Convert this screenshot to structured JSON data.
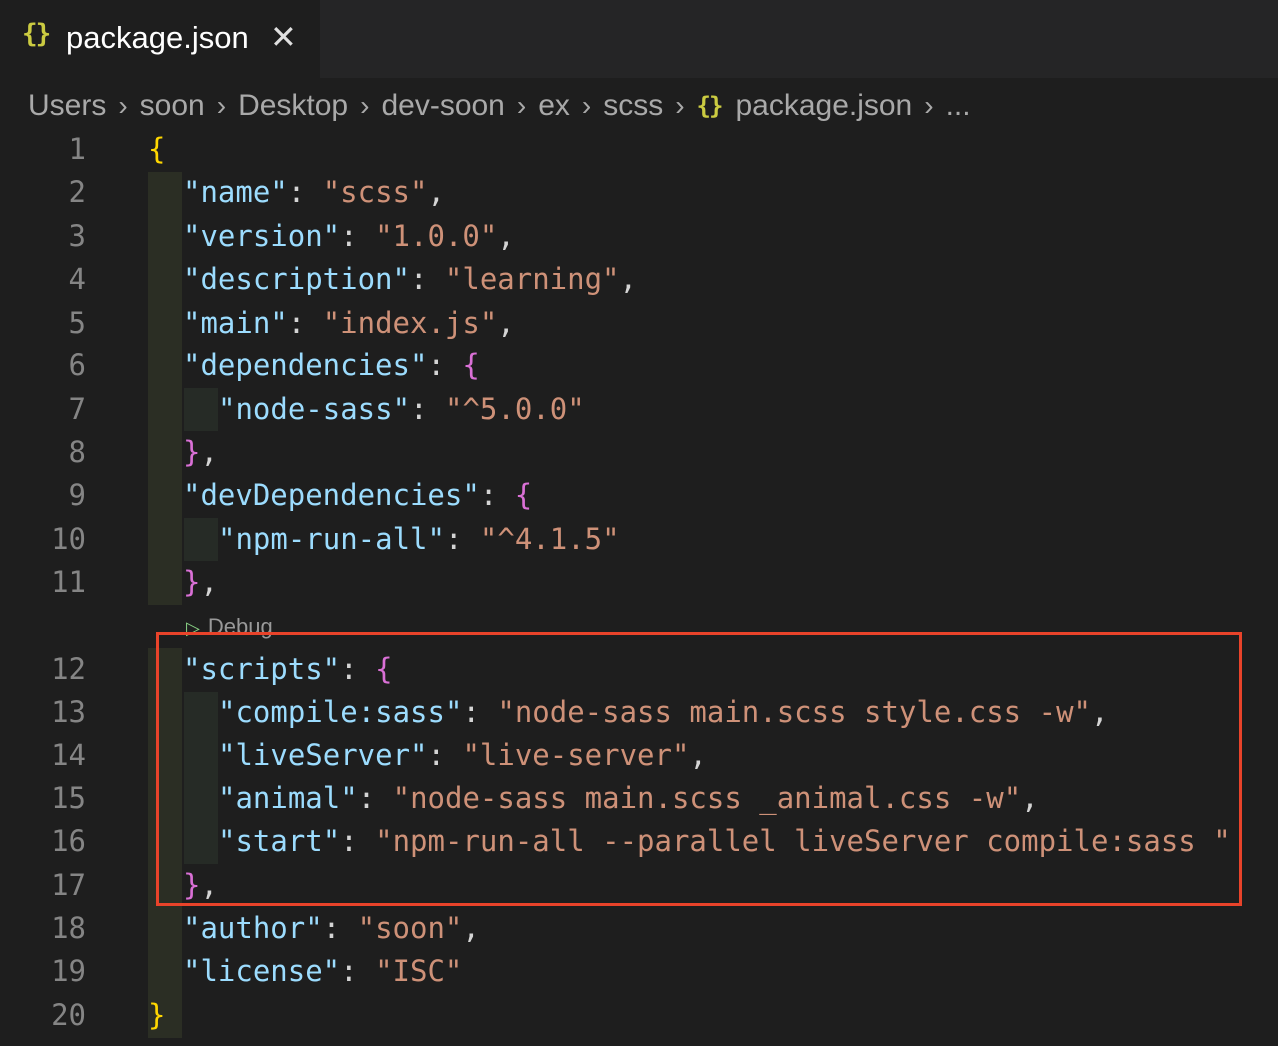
{
  "tab": {
    "icon": "json-braces-icon",
    "icon_text": "{}",
    "title": "package.json",
    "close": "✕"
  },
  "breadcrumb": {
    "items": [
      "Users",
      "soon",
      "Desktop",
      "dev-soon",
      "ex",
      "scss"
    ],
    "file_icon_text": "{}",
    "file": "package.json",
    "ellipsis": "...",
    "separator": "›"
  },
  "codelens": {
    "label": "Debug",
    "icon": "play-icon"
  },
  "lines": [
    {
      "n": "1",
      "tokens": [
        [
          "b1",
          "{"
        ]
      ]
    },
    {
      "n": "2",
      "tokens": [
        [
          "k",
          "\"name\""
        ],
        [
          "p",
          ": "
        ],
        [
          "s",
          "\"scss\""
        ],
        [
          "p",
          ","
        ]
      ]
    },
    {
      "n": "3",
      "tokens": [
        [
          "k",
          "\"version\""
        ],
        [
          "p",
          ": "
        ],
        [
          "s",
          "\"1.0.0\""
        ],
        [
          "p",
          ","
        ]
      ]
    },
    {
      "n": "4",
      "tokens": [
        [
          "k",
          "\"description\""
        ],
        [
          "p",
          ": "
        ],
        [
          "s",
          "\"learning\""
        ],
        [
          "p",
          ","
        ]
      ]
    },
    {
      "n": "5",
      "tokens": [
        [
          "k",
          "\"main\""
        ],
        [
          "p",
          ": "
        ],
        [
          "s",
          "\"index.js\""
        ],
        [
          "p",
          ","
        ]
      ]
    },
    {
      "n": "6",
      "tokens": [
        [
          "k",
          "\"dependencies\""
        ],
        [
          "p",
          ": "
        ],
        [
          "b2",
          "{"
        ]
      ]
    },
    {
      "n": "7",
      "tokens": [
        [
          "k",
          "\"node-sass\""
        ],
        [
          "p",
          ": "
        ],
        [
          "s",
          "\"^5.0.0\""
        ]
      ]
    },
    {
      "n": "8",
      "tokens": [
        [
          "b2",
          "}"
        ],
        [
          "p",
          ","
        ]
      ]
    },
    {
      "n": "9",
      "tokens": [
        [
          "k",
          "\"devDependencies\""
        ],
        [
          "p",
          ": "
        ],
        [
          "b2",
          "{"
        ]
      ]
    },
    {
      "n": "10",
      "tokens": [
        [
          "k",
          "\"npm-run-all\""
        ],
        [
          "p",
          ": "
        ],
        [
          "s",
          "\"^4.1.5\""
        ]
      ]
    },
    {
      "n": "11",
      "tokens": [
        [
          "b2",
          "}"
        ],
        [
          "p",
          ","
        ]
      ]
    },
    {
      "n": "12",
      "tokens": [
        [
          "k",
          "\"scripts\""
        ],
        [
          "p",
          ": "
        ],
        [
          "b2",
          "{"
        ]
      ]
    },
    {
      "n": "13",
      "tokens": [
        [
          "k",
          "\"compile:sass\""
        ],
        [
          "p",
          ": "
        ],
        [
          "s",
          "\"node-sass main.scss style.css -w\""
        ],
        [
          "p",
          ","
        ]
      ]
    },
    {
      "n": "14",
      "tokens": [
        [
          "k",
          "\"liveServer\""
        ],
        [
          "p",
          ": "
        ],
        [
          "s",
          "\"live-server\""
        ],
        [
          "p",
          ","
        ]
      ]
    },
    {
      "n": "15",
      "tokens": [
        [
          "k",
          "\"animal\""
        ],
        [
          "p",
          ": "
        ],
        [
          "s",
          "\"node-sass main.scss _animal.css -w\""
        ],
        [
          "p",
          ","
        ]
      ]
    },
    {
      "n": "16",
      "tokens": [
        [
          "k",
          "\"start\""
        ],
        [
          "p",
          ": "
        ],
        [
          "s",
          "\"npm-run-all --parallel liveServer compile:sass \""
        ]
      ]
    },
    {
      "n": "17",
      "tokens": [
        [
          "b2",
          "}"
        ],
        [
          "p",
          ","
        ]
      ]
    },
    {
      "n": "18",
      "tokens": [
        [
          "k",
          "\"author\""
        ],
        [
          "p",
          ": "
        ],
        [
          "s",
          "\"soon\""
        ],
        [
          "p",
          ","
        ]
      ]
    },
    {
      "n": "19",
      "tokens": [
        [
          "k",
          "\"license\""
        ],
        [
          "p",
          ": "
        ],
        [
          "s",
          "\"ISC\""
        ]
      ]
    },
    {
      "n": "20",
      "tokens": [
        [
          "b1",
          "}"
        ]
      ]
    }
  ]
}
